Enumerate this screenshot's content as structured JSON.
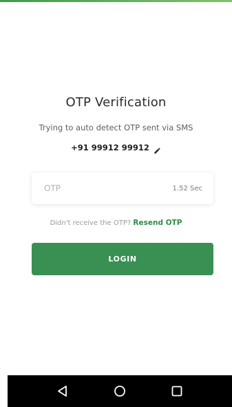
{
  "header": {
    "title": "OTP Verification",
    "subtitle": "Trying to auto detect OTP sent via SMS",
    "phone_number": "+91 99912 99912",
    "edit_icon": "pencil-icon"
  },
  "otp": {
    "placeholder": "OTP",
    "value": "",
    "timer": "1.52 Sec"
  },
  "resend": {
    "prompt": "Didn't receive the OTP?",
    "link_label": "Resend OTP"
  },
  "login": {
    "label": "LOGIN"
  },
  "nav": {
    "back_icon": "back-triangle-icon",
    "home_icon": "home-circle-icon",
    "recents_icon": "recents-square-icon"
  },
  "colors": {
    "accent": "#3a8f53",
    "link": "#2e8b47",
    "nav_background": "#000000"
  }
}
